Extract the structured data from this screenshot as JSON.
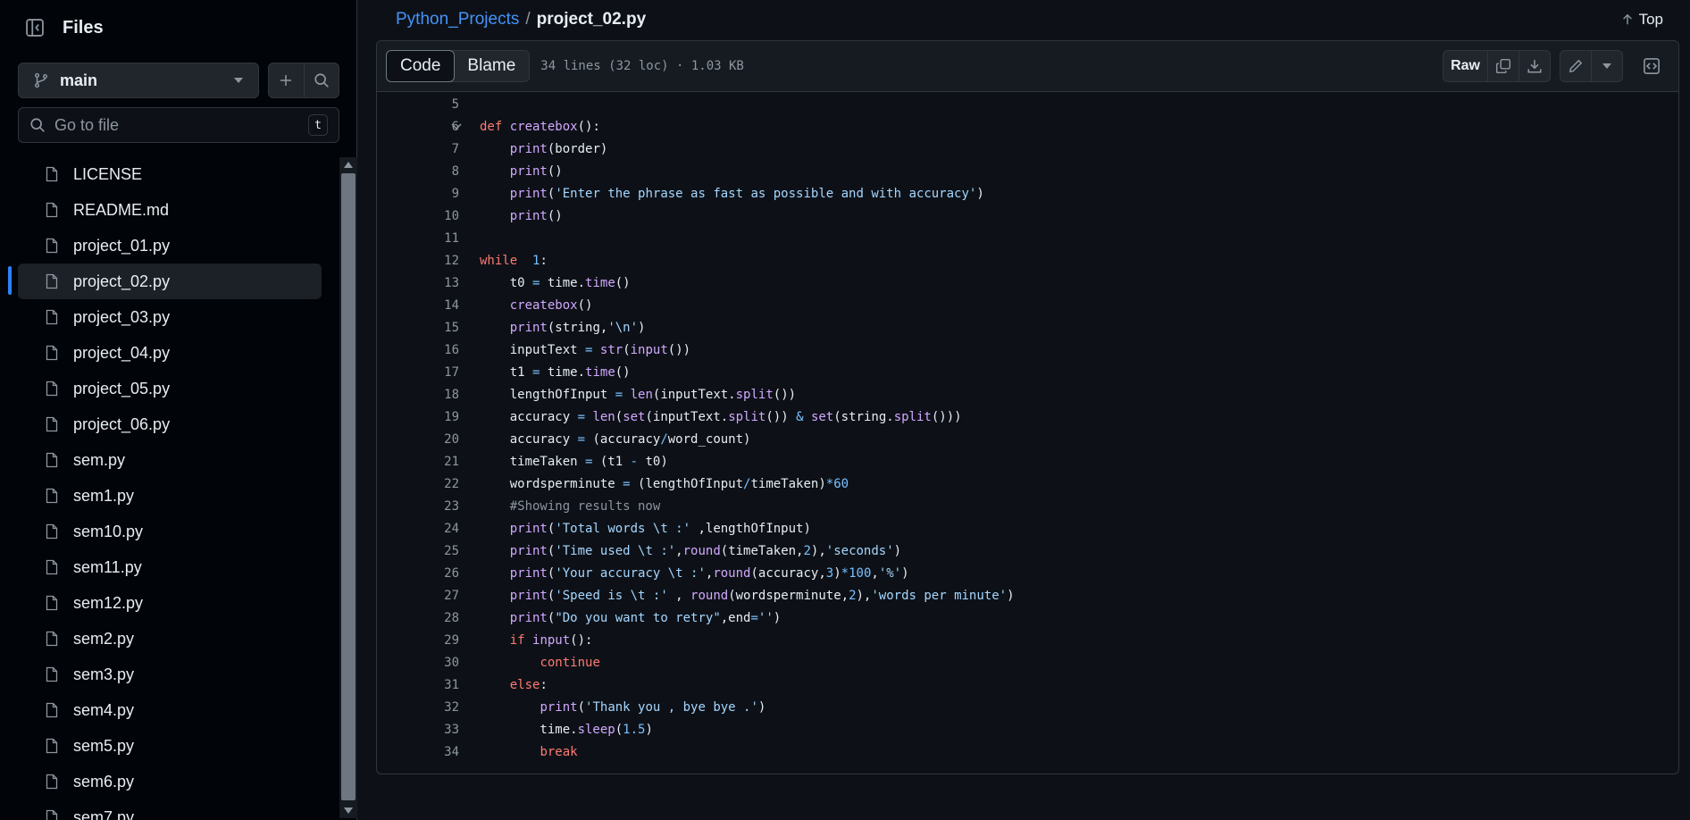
{
  "sidebar": {
    "title": "Files",
    "branch": "main",
    "goto_placeholder": "Go to file",
    "goto_shortcut": "t",
    "files": [
      "LICENSE",
      "README.md",
      "project_01.py",
      "project_02.py",
      "project_03.py",
      "project_04.py",
      "project_05.py",
      "project_06.py",
      "sem.py",
      "sem1.py",
      "sem10.py",
      "sem11.py",
      "sem12.py",
      "sem2.py",
      "sem3.py",
      "sem4.py",
      "sem5.py",
      "sem6.py",
      "sem7.py"
    ],
    "active_file": "project_02.py"
  },
  "header": {
    "repo": "Python_Projects",
    "separator": "/",
    "file": "project_02.py",
    "top_label": "Top"
  },
  "toolbar": {
    "code_tab": "Code",
    "blame_tab": "Blame",
    "meta": "34 lines (32 loc) · 1.03 KB",
    "raw_label": "Raw"
  },
  "code_lines": [
    {
      "n": "5",
      "text": ""
    },
    {
      "n": "6",
      "text": "def createbox():",
      "fold": true
    },
    {
      "n": "7",
      "text": "    print(border)"
    },
    {
      "n": "8",
      "text": "    print()"
    },
    {
      "n": "9",
      "text": "    print('Enter the phrase as fast as possible and with accuracy')"
    },
    {
      "n": "10",
      "text": "    print()"
    },
    {
      "n": "11",
      "text": ""
    },
    {
      "n": "12",
      "text": "while  1:"
    },
    {
      "n": "13",
      "text": "    t0 = time.time()"
    },
    {
      "n": "14",
      "text": "    createbox()"
    },
    {
      "n": "15",
      "text": "    print(string,'\\n')"
    },
    {
      "n": "16",
      "text": "    inputText = str(input())"
    },
    {
      "n": "17",
      "text": "    t1 = time.time()"
    },
    {
      "n": "18",
      "text": "    lengthOfInput = len(inputText.split())"
    },
    {
      "n": "19",
      "text": "    accuracy = len(set(inputText.split()) & set(string.split()))"
    },
    {
      "n": "20",
      "text": "    accuracy = (accuracy/word_count)"
    },
    {
      "n": "21",
      "text": "    timeTaken = (t1 - t0)"
    },
    {
      "n": "22",
      "text": "    wordsperminute = (lengthOfInput/timeTaken)*60"
    },
    {
      "n": "23",
      "text": "    #Showing results now"
    },
    {
      "n": "24",
      "text": "    print('Total words \\t :' ,lengthOfInput)"
    },
    {
      "n": "25",
      "text": "    print('Time used \\t :',round(timeTaken,2),'seconds')"
    },
    {
      "n": "26",
      "text": "    print('Your accuracy \\t :',round(accuracy,3)*100,'%')"
    },
    {
      "n": "27",
      "text": "    print('Speed is \\t :' , round(wordsperminute,2),'words per minute')"
    },
    {
      "n": "28",
      "text": "    print(\"Do you want to retry\",end='')"
    },
    {
      "n": "29",
      "text": "    if input():"
    },
    {
      "n": "30",
      "text": "        continue"
    },
    {
      "n": "31",
      "text": "    else:"
    },
    {
      "n": "32",
      "text": "        print('Thank you , bye bye .')"
    },
    {
      "n": "33",
      "text": "        time.sleep(1.5)"
    },
    {
      "n": "34",
      "text": "        break"
    }
  ],
  "colors": {
    "accent": "#2f81f7",
    "link": "#4493f8",
    "keyword": "#ff7b72",
    "function": "#d2a8ff",
    "string": "#a5d6ff",
    "number": "#79c0ff"
  }
}
